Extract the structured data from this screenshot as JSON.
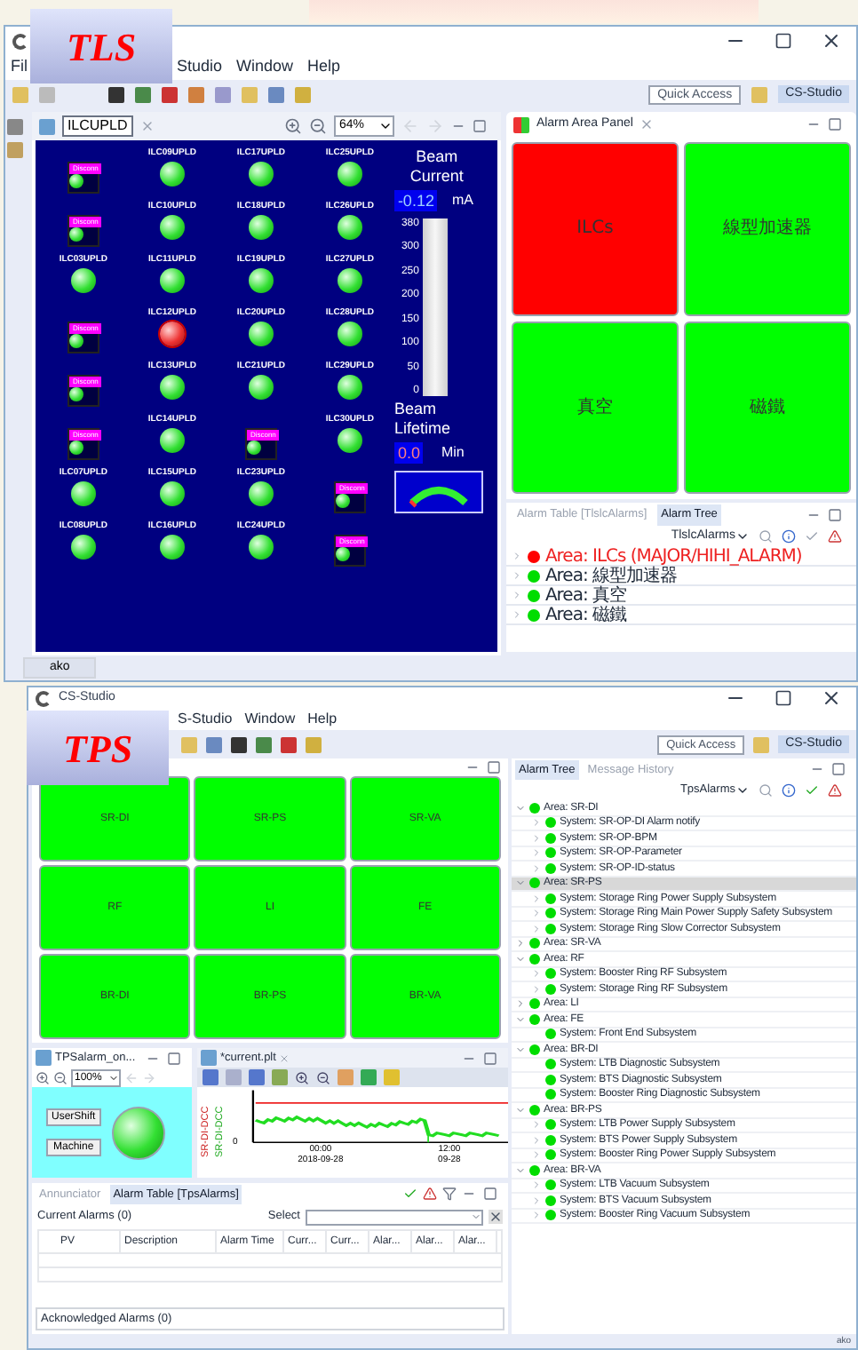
{
  "tls": {
    "badge": "TLS",
    "menu": [
      "Fil",
      "Studio",
      "Window",
      "Help"
    ],
    "quick_access": "Quick Access",
    "perspective": "CS-Studio",
    "display": {
      "tab": "ILCUPLD",
      "zoom": "64%",
      "columns": [
        [
          {
            "disconnected": true,
            "alarm": false,
            "badge": "Disconn"
          },
          {
            "disconnected": true,
            "alarm": false,
            "badge": "Disconn"
          },
          {
            "label": "ILC03UPLD",
            "disconnected": false,
            "alarm": false
          },
          {
            "disconnected": true,
            "alarm": false,
            "badge": "Disconn"
          },
          {
            "disconnected": true,
            "alarm": false,
            "badge": "Disconn"
          },
          {
            "disconnected": true,
            "alarm": false,
            "badge": "Disconn"
          },
          {
            "label": "ILC07UPLD",
            "disconnected": false,
            "alarm": false
          },
          {
            "label": "ILC08UPLD",
            "disconnected": false,
            "alarm": false
          }
        ],
        [
          {
            "label": "ILC09UPLD",
            "disconnected": false,
            "alarm": false
          },
          {
            "label": "ILC10UPLD",
            "disconnected": false,
            "alarm": false
          },
          {
            "label": "ILC11UPLD",
            "disconnected": false,
            "alarm": false
          },
          {
            "label": "ILC12UPLD",
            "disconnected": false,
            "alarm": true
          },
          {
            "label": "ILC13UPLD",
            "disconnected": false,
            "alarm": false
          },
          {
            "label": "ILC14UPLD",
            "disconnected": false,
            "alarm": false
          },
          {
            "label": "ILC15UPLD",
            "disconnected": false,
            "alarm": false
          },
          {
            "label": "ILC16UPLD",
            "disconnected": false,
            "alarm": false
          }
        ],
        [
          {
            "label": "ILC17UPLD",
            "disconnected": false,
            "alarm": false
          },
          {
            "label": "ILC18UPLD",
            "disconnected": false,
            "alarm": false
          },
          {
            "label": "ILC19UPLD",
            "disconnected": false,
            "alarm": false
          },
          {
            "label": "ILC20UPLD",
            "disconnected": false,
            "alarm": false
          },
          {
            "label": "ILC21UPLD",
            "disconnected": false,
            "alarm": false
          },
          {
            "disconnected": true,
            "alarm": false,
            "badge": "Disconn"
          },
          {
            "label": "ILC23UPLD",
            "disconnected": false,
            "alarm": false
          },
          {
            "label": "ILC24UPLD",
            "disconnected": false,
            "alarm": false
          }
        ],
        [
          {
            "label": "ILC25UPLD",
            "disconnected": false,
            "alarm": false
          },
          {
            "label": "ILC26UPLD",
            "disconnected": false,
            "alarm": false
          },
          {
            "label": "ILC27UPLD",
            "disconnected": false,
            "alarm": false
          },
          {
            "label": "ILC28UPLD",
            "disconnected": false,
            "alarm": false
          },
          {
            "label": "ILC29UPLD",
            "disconnected": false,
            "alarm": false
          },
          {
            "label": "ILC30UPLD",
            "disconnected": false,
            "alarm": false
          },
          {
            "disconnected": true,
            "alarm": false,
            "badge": "Disconn"
          },
          {
            "disconnected": true,
            "alarm": false,
            "badge": "Disconn"
          }
        ]
      ],
      "beam_current": {
        "title": "Beam Current",
        "value": "-0.12",
        "unit": "mA",
        "level": 0,
        "ticks": [
          "380",
          "300",
          "250",
          "200",
          "150",
          "100",
          "50",
          "0"
        ]
      },
      "beam_lifetime": {
        "title": "Beam Lifetime",
        "value": "0.0",
        "unit": "Min"
      }
    },
    "area_panel": {
      "title": "Alarm Area Panel",
      "tiles": [
        {
          "label": "ILCs",
          "color": "#ff0000"
        },
        {
          "label": "線型加速器",
          "color": "#00ff00"
        },
        {
          "label": "真空",
          "color": "#00ff00"
        },
        {
          "label": "磁鐵",
          "color": "#00ff00"
        }
      ]
    },
    "alarm_views": {
      "tabs": [
        {
          "label": "Alarm Table [TlslcAlarms]",
          "selected": false
        },
        {
          "label": "Alarm Tree",
          "selected": true
        }
      ],
      "config": "TlslcAlarms",
      "items": [
        {
          "label": "Area: ILCs (MAJOR/HIHI_ALARM)",
          "color": "#ff0000",
          "alarm": true
        },
        {
          "label": "Area: 線型加速器",
          "color": "#00dd00",
          "alarm": false
        },
        {
          "label": "Area: 真空",
          "color": "#00dd00",
          "alarm": false
        },
        {
          "label": "Area: 磁鐵",
          "color": "#00dd00",
          "alarm": false
        }
      ]
    },
    "status": "ako"
  },
  "tps": {
    "badge": "TPS",
    "title": "CS-Studio",
    "menu": [
      "S-Studio",
      "Window",
      "Help"
    ],
    "quick_access": "Quick Access",
    "perspective": "CS-Studio",
    "area_panel": {
      "tiles": [
        {
          "label": "SR-DI",
          "color": "#00ff00"
        },
        {
          "label": "SR-PS",
          "color": "#00ff00"
        },
        {
          "label": "SR-VA",
          "color": "#00ff00"
        },
        {
          "label": "RF",
          "color": "#00ff00"
        },
        {
          "label": "LI",
          "color": "#00ff00"
        },
        {
          "label": "FE",
          "color": "#00ff00"
        },
        {
          "label": "BR-DI",
          "color": "#00ff00"
        },
        {
          "label": "BR-PS",
          "color": "#00ff00"
        },
        {
          "label": "BR-VA",
          "color": "#00ff00"
        }
      ]
    },
    "display": {
      "tab": "TPSalarm_on...",
      "zoom": "100%",
      "buttons": [
        "UserShift",
        "Machine"
      ]
    },
    "plot": {
      "tab": "*current.plt",
      "axis_titles": [
        "SR-DI-DCC",
        "SR-DI-DCC"
      ],
      "y_tick": "0",
      "x_ticks": [
        {
          "time": "00:00",
          "date": "2018-09-28"
        },
        {
          "time": "12:00",
          "date": "09-28"
        }
      ]
    },
    "alarm_table": {
      "tabs": [
        {
          "label": "Annunciator",
          "selected": false
        },
        {
          "label": "Alarm Table [TpsAlarms]",
          "selected": true
        }
      ],
      "current": "Current Alarms (0)",
      "select_label": "Select",
      "columns": [
        "PV",
        "Description",
        "Alarm Time",
        "Curr...",
        "Curr...",
        "Alar...",
        "Alar...",
        "Alar..."
      ],
      "acknowledged": "Acknowledged Alarms (0)"
    },
    "alarm_tree": {
      "tabs": [
        {
          "label": "Alarm Tree",
          "selected": true
        },
        {
          "label": "Message History",
          "selected": false
        }
      ],
      "config": "TpsAlarms",
      "items": [
        {
          "label": "Area: SR-DI",
          "color": "#00dd00",
          "expanded": true,
          "selected": false,
          "children": [
            {
              "label": "System: SR-OP-DI Alarm notify",
              "color": "#00dd00",
              "expandable": true
            },
            {
              "label": "System: SR-OP-BPM",
              "color": "#00dd00",
              "expandable": true
            },
            {
              "label": "System: SR-OP-Parameter",
              "color": "#00dd00",
              "expandable": true
            },
            {
              "label": "System: SR-OP-ID-status",
              "color": "#00dd00",
              "expandable": true
            }
          ]
        },
        {
          "label": "Area: SR-PS",
          "color": "#00dd00",
          "expanded": true,
          "selected": true,
          "children": [
            {
              "label": "System: Storage Ring Power Supply Subsystem",
              "color": "#00dd00",
              "expandable": true
            },
            {
              "label": "System: Storage Ring Main Power Supply Safety Subsystem",
              "color": "#00dd00",
              "expandable": true
            },
            {
              "label": "System: Storage Ring Slow Corrector Subsystem",
              "color": "#00dd00",
              "expandable": true
            }
          ]
        },
        {
          "label": "Area: SR-VA",
          "color": "#00dd00",
          "expanded": false,
          "selected": false
        },
        {
          "label": "Area: RF",
          "color": "#00dd00",
          "expanded": true,
          "selected": false,
          "children": [
            {
              "label": "System: Booster Ring RF Subsystem",
              "color": "#00dd00",
              "expandable": true
            },
            {
              "label": "System: Storage Ring RF Subsystem",
              "color": "#00dd00",
              "expandable": true
            }
          ]
        },
        {
          "label": "Area: LI",
          "color": "#00dd00",
          "expanded": false,
          "selected": false
        },
        {
          "label": "Area: FE",
          "color": "#00dd00",
          "expanded": true,
          "selected": false,
          "children": [
            {
              "label": "System: Front End Subsystem",
              "color": "#00dd00",
              "expandable": false
            }
          ]
        },
        {
          "label": "Area: BR-DI",
          "color": "#00dd00",
          "expanded": true,
          "selected": false,
          "children": [
            {
              "label": "System: LTB Diagnostic Subsystem",
              "color": "#00dd00",
              "expandable": false
            },
            {
              "label": "System: BTS Diagnostic Subsystem",
              "color": "#00dd00",
              "expandable": false
            },
            {
              "label": "System: Booster Ring Diagnostic Subsystem",
              "color": "#00dd00",
              "expandable": false
            }
          ]
        },
        {
          "label": "Area: BR-PS",
          "color": "#00dd00",
          "expanded": true,
          "selected": false,
          "children": [
            {
              "label": "System: LTB Power Supply Subsystem",
              "color": "#00dd00",
              "expandable": true
            },
            {
              "label": "System: BTS Power Supply Subsystem",
              "color": "#00dd00",
              "expandable": true
            },
            {
              "label": "System: Booster Ring Power Supply Subsystem",
              "color": "#00dd00",
              "expandable": true
            }
          ]
        },
        {
          "label": "Area: BR-VA",
          "color": "#00dd00",
          "expanded": true,
          "selected": false,
          "children": [
            {
              "label": "System: LTB Vacuum Subsystem",
              "color": "#00dd00",
              "expandable": true
            },
            {
              "label": "System: BTS Vacuum Subsystem",
              "color": "#00dd00",
              "expandable": true
            },
            {
              "label": "System: Booster Ring Vacuum Subsystem",
              "color": "#00dd00",
              "expandable": true
            }
          ]
        }
      ]
    },
    "status": "ako"
  }
}
